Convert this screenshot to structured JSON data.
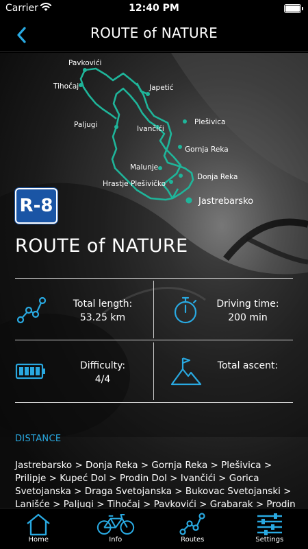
{
  "status_bar": {
    "carrier": "Carrier",
    "time": "12:40 PM"
  },
  "header": {
    "title": "ROUTE  of NATURE"
  },
  "route": {
    "badge": "R-8",
    "title": "ROUTE  of NATURE",
    "map_places": {
      "pavkovici": "Pavkovići",
      "tihocaj": "Tihočaj",
      "japetic": "Japetić",
      "paljugi": "Paljugi",
      "ivancici": "Ivančići",
      "plesivica": "Plešivica",
      "gornja_reka": "Gornja Reka",
      "malunje": "Malunje",
      "donja_reka": "Donja Reka",
      "hrastje": "Hrastje Plešivičko",
      "jastrebarsko": "Jastrebarsko"
    },
    "route_color": "#1fb59a"
  },
  "stats": {
    "length_label": "Total length:",
    "length_value": "53.25 km",
    "driving_label": "Driving time:",
    "driving_value": "200 min",
    "difficulty_label": "Difficulty:",
    "difficulty_value": "4/4",
    "ascent_label": "Total ascent:",
    "icon_color": "#29a9e1"
  },
  "distance": {
    "heading": "DISTANCE",
    "text": "Jastrebarsko > Donja Reka > Gornja Reka > Plešivica > Prilipje > Kupeć Dol > Prodin Dol > Ivančići > Gorica Svetojanska > Draga Svetojanska > Bukovac Svetojanski > Lanišće > Paljugi > Tihočaj > Pavkovići > Grabarak > Prodin"
  },
  "tabs": [
    {
      "label": "Home",
      "icon": "home-icon"
    },
    {
      "label": "Info",
      "icon": "bicycle-icon"
    },
    {
      "label": "Routes",
      "icon": "routes-icon"
    },
    {
      "label": "Settings",
      "icon": "sliders-icon"
    }
  ],
  "colors": {
    "accent": "#29a9e1",
    "badge": "#1a55a5",
    "route": "#1fb59a"
  }
}
